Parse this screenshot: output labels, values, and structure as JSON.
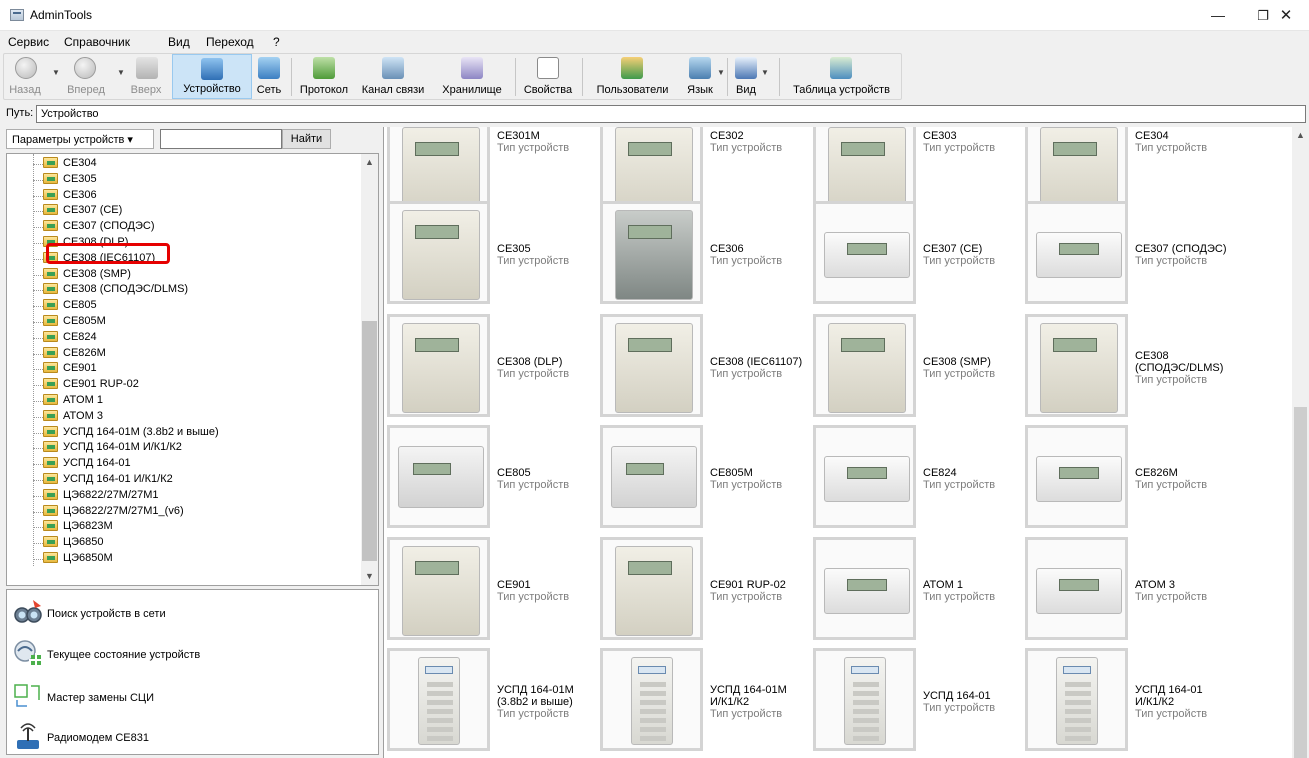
{
  "window": {
    "title": "AdminTools",
    "minimize": "—",
    "maximize": "❐",
    "close": "✕"
  },
  "menu": [
    "Сервис",
    "Справочник",
    "Вид",
    "Переход",
    "?"
  ],
  "toolbar": {
    "back": "Назад",
    "forward": "Вперед",
    "up": "Вверх",
    "device": "Устройство",
    "network": "Сеть",
    "protocol": "Протокол",
    "channel": "Канал связи",
    "storage": "Хранилище",
    "properties": "Свойства",
    "users": "Пользователи",
    "language": "Язык",
    "view": "Вид",
    "device_table": "Таблица устройств"
  },
  "path": {
    "label": "Путь:",
    "value": "Устройство"
  },
  "left": {
    "params_button": "Параметры устройств ▾",
    "search_value": "",
    "find_button": "Найти",
    "tree": [
      "CE304",
      "CE305",
      "CE306",
      "CE307 (CE)",
      "CE307 (СПОДЭС)",
      "CE308 (DLP)",
      "CE308 (IEC61107)",
      "CE308 (SMP)",
      "CE308 (СПОДЭС/DLMS)",
      "CE805",
      "CE805M",
      "CE824",
      "CE826M",
      "CE901",
      "CE901 RUP-02",
      "ATOM 1",
      "ATOM 3",
      "УСПД 164-01М (3.8b2 и выше)",
      "УСПД 164-01М И/К1/К2",
      "УСПД 164-01",
      "УСПД 164-01 И/К1/К2",
      "ЦЭ6822/27М/27М1",
      "ЦЭ6822/27М/27М1_(v6)",
      "ЦЭ6823М",
      "ЦЭ6850",
      "ЦЭ6850М"
    ],
    "highlighted_index": 4,
    "tasks": [
      {
        "label": "Поиск устройств в сети",
        "icon": "binoculars-icon"
      },
      {
        "label": "Текущее состояние устройств",
        "icon": "status-icon"
      },
      {
        "label": "Мастер замены СЦИ",
        "icon": "replace-icon"
      },
      {
        "label": "Радиомодем CE831",
        "icon": "radio-icon"
      }
    ]
  },
  "grid": {
    "type_label": "Тип устройств",
    "rows": [
      [
        "CE301M",
        "CE302",
        "CE303",
        "CE304"
      ],
      [
        "CE305",
        "CE306",
        "CE307 (CE)",
        "CE307 (СПОДЭС)"
      ],
      [
        "CE308 (DLP)",
        "CE308 (IEC61107)",
        "CE308 (SMP)",
        "CE308\n(СПОДЭС/DLMS)"
      ],
      [
        "CE805",
        "CE805M",
        "CE824",
        "CE826M"
      ],
      [
        "CE901",
        "CE901 RUP-02",
        "ATOM 1",
        "ATOM 3"
      ],
      [
        "УСПД 164-01М\n(3.8b2 и выше)",
        "УСПД 164-01М\nИ/К1/К2",
        "УСПД 164-01",
        "УСПД 164-01\nИ/К1/К2"
      ]
    ]
  },
  "colors": {
    "highlight": "#e60000",
    "active_tool": "#cce4f7",
    "type_text": "#7d7d7d"
  }
}
